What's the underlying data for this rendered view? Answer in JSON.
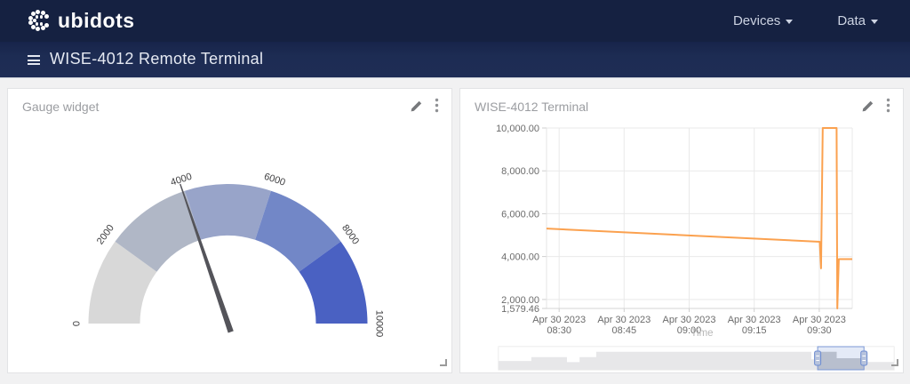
{
  "navbar": {
    "logo_text": "ubidots",
    "items": [
      {
        "label": "Devices"
      },
      {
        "label": "Data"
      }
    ]
  },
  "subheader": {
    "title": "WISE-4012 Remote Terminal"
  },
  "widgets": {
    "gauge": {
      "title": "Gauge widget"
    },
    "terminal": {
      "title": "WISE-4012 Terminal"
    }
  },
  "chart_data": [
    {
      "type": "gauge",
      "title": "Gauge widget",
      "min": 0,
      "max": 10000,
      "tick_labels": [
        "0",
        "2000",
        "4000",
        "6000",
        "8000",
        "10000"
      ],
      "segments": [
        {
          "from": 0,
          "to": 2000,
          "color": "#d8d8d8"
        },
        {
          "from": 2000,
          "to": 4000,
          "color": "#b0b7c6"
        },
        {
          "from": 4000,
          "to": 6000,
          "color": "#98a4c9"
        },
        {
          "from": 6000,
          "to": 8000,
          "color": "#7287c7"
        },
        {
          "from": 8000,
          "to": 10000,
          "color": "#4a61c2"
        }
      ],
      "value": 3950,
      "needle_color": "#54545a"
    },
    {
      "type": "line",
      "title": "WISE-4012 Terminal",
      "xlabel": "Time",
      "line_color": "#fba14f",
      "ylim": [
        1579.46,
        10000
      ],
      "y_axis_min_label": "1,579.46",
      "y_ticks": [
        {
          "value": 10000,
          "label": "10,000.00"
        },
        {
          "value": 8000,
          "label": "8,000.00"
        },
        {
          "value": 6000,
          "label": "6,000.00"
        },
        {
          "value": 4000,
          "label": "4,000.00"
        },
        {
          "value": 2000,
          "label": "2,000.00"
        }
      ],
      "x_ticks": [
        {
          "t": 0,
          "date": "Apr 30 2023",
          "time": "08:30"
        },
        {
          "t": 15,
          "date": "Apr 30 2023",
          "time": "08:45"
        },
        {
          "t": 30,
          "date": "Apr 30 2023",
          "time": "09:00"
        },
        {
          "t": 45,
          "date": "Apr 30 2023",
          "time": "09:15"
        },
        {
          "t": 60,
          "date": "Apr 30 2023",
          "time": "09:30"
        }
      ],
      "x_minutes_range": [
        -2.9,
        67.6
      ],
      "points_t_minutes_value": [
        [
          -2.9,
          5310
        ],
        [
          60.1,
          4690
        ],
        [
          60.4,
          3450
        ],
        [
          60.8,
          10000
        ],
        [
          64.0,
          10000
        ],
        [
          64.15,
          1579.46
        ],
        [
          64.5,
          3880
        ],
        [
          67.6,
          3880
        ]
      ],
      "navigator": {
        "selection_fraction": [
          0.807,
          0.924
        ],
        "silhouette_steps": [
          [
            0,
            0.38
          ],
          [
            0.083,
            0.38
          ],
          [
            0.083,
            0.55
          ],
          [
            0.173,
            0.55
          ],
          [
            0.173,
            0.33
          ],
          [
            0.205,
            0.33
          ],
          [
            0.205,
            0.55
          ],
          [
            0.247,
            0.55
          ],
          [
            0.247,
            0.78
          ],
          [
            0.791,
            0.78
          ],
          [
            0.791,
            0.45
          ],
          [
            0.812,
            0.45
          ],
          [
            0.812,
            0.78
          ],
          [
            0.829,
            0.78
          ],
          [
            0.855,
            0.78
          ],
          [
            0.855,
            0.5
          ],
          [
            0.932,
            0.5
          ],
          [
            0.932,
            0.34
          ],
          [
            1,
            0.34
          ]
        ]
      }
    }
  ]
}
